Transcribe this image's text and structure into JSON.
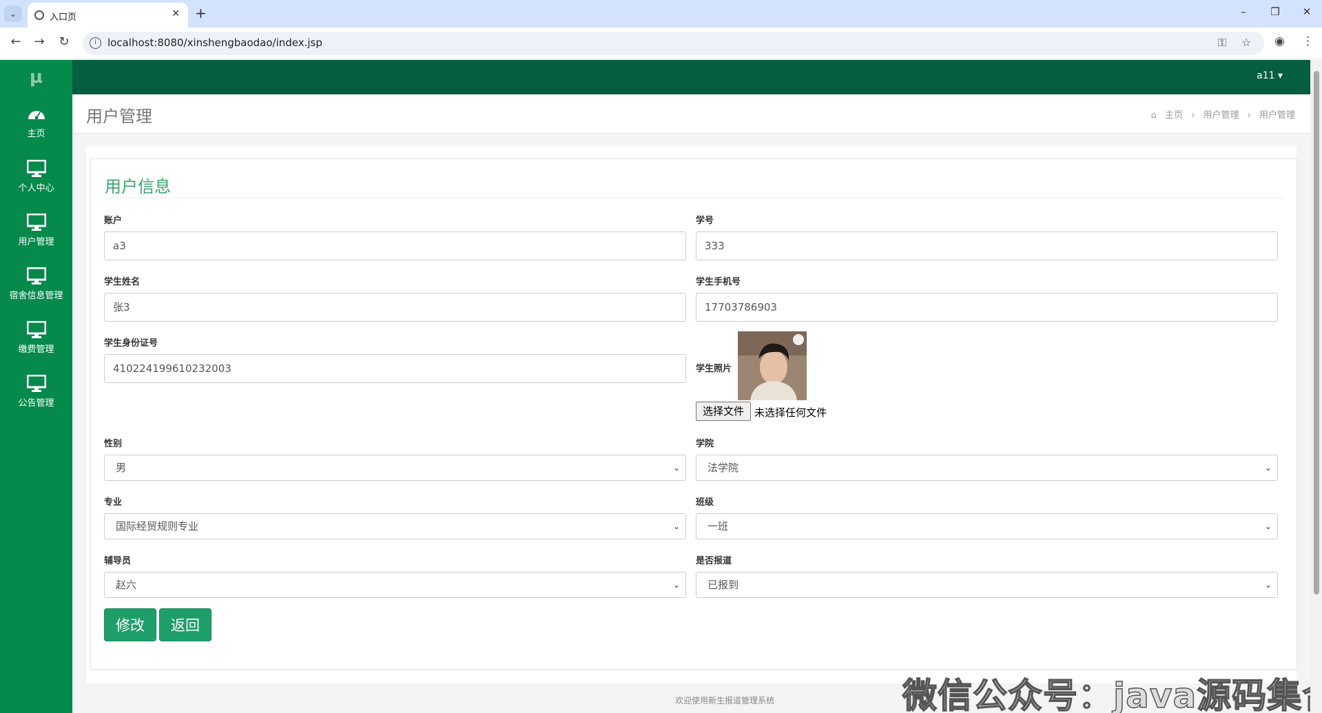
{
  "browser": {
    "tab_title": "入口页",
    "url": "localhost:8080/xinshengbaodao/index.jsp"
  },
  "app": {
    "logo": "μ",
    "user": "a11 ▾"
  },
  "sidebar": {
    "items": [
      {
        "label": "主页",
        "icon": "dashboard-icon"
      },
      {
        "label": "个人中心",
        "icon": "monitor-icon"
      },
      {
        "label": "用户管理",
        "icon": "monitor-icon"
      },
      {
        "label": "宿舍信息管理",
        "icon": "monitor-icon"
      },
      {
        "label": "缴费管理",
        "icon": "monitor-icon"
      },
      {
        "label": "公告管理",
        "icon": "monitor-icon"
      }
    ]
  },
  "header": {
    "title": "用户管理",
    "breadcrumb": [
      "主页",
      "用户管理",
      "用户管理"
    ]
  },
  "form": {
    "title": "用户信息",
    "fields": {
      "account": {
        "label": "账户",
        "value": "a3"
      },
      "student_no": {
        "label": "学号",
        "value": "333"
      },
      "name": {
        "label": "学生姓名",
        "value": "张3"
      },
      "phone": {
        "label": "学生手机号",
        "value": "17703786903"
      },
      "id_card": {
        "label": "学生身份证号",
        "value": "410224199610232003"
      },
      "photo": {
        "label": "学生照片",
        "file_button": "选择文件",
        "file_status": "未选择任何文件"
      },
      "gender": {
        "label": "性别",
        "value": "男"
      },
      "college": {
        "label": "学院",
        "value": "法学院"
      },
      "major": {
        "label": "专业",
        "value": "国际经贸规则专业"
      },
      "class": {
        "label": "班级",
        "value": "一班"
      },
      "counselor": {
        "label": "辅导员",
        "value": "赵六"
      },
      "reported": {
        "label": "是否报道",
        "value": "已报到"
      }
    },
    "buttons": {
      "modify": "修改",
      "back": "返回"
    }
  },
  "footer": "欢迎使用新生报道管理系统",
  "watermark": "微信公众号：java源码集合",
  "colors": {
    "sidebar": "#058a4b",
    "topbar": "#055f3f",
    "accent": "#1e9e69",
    "title": "#3aa86b"
  }
}
